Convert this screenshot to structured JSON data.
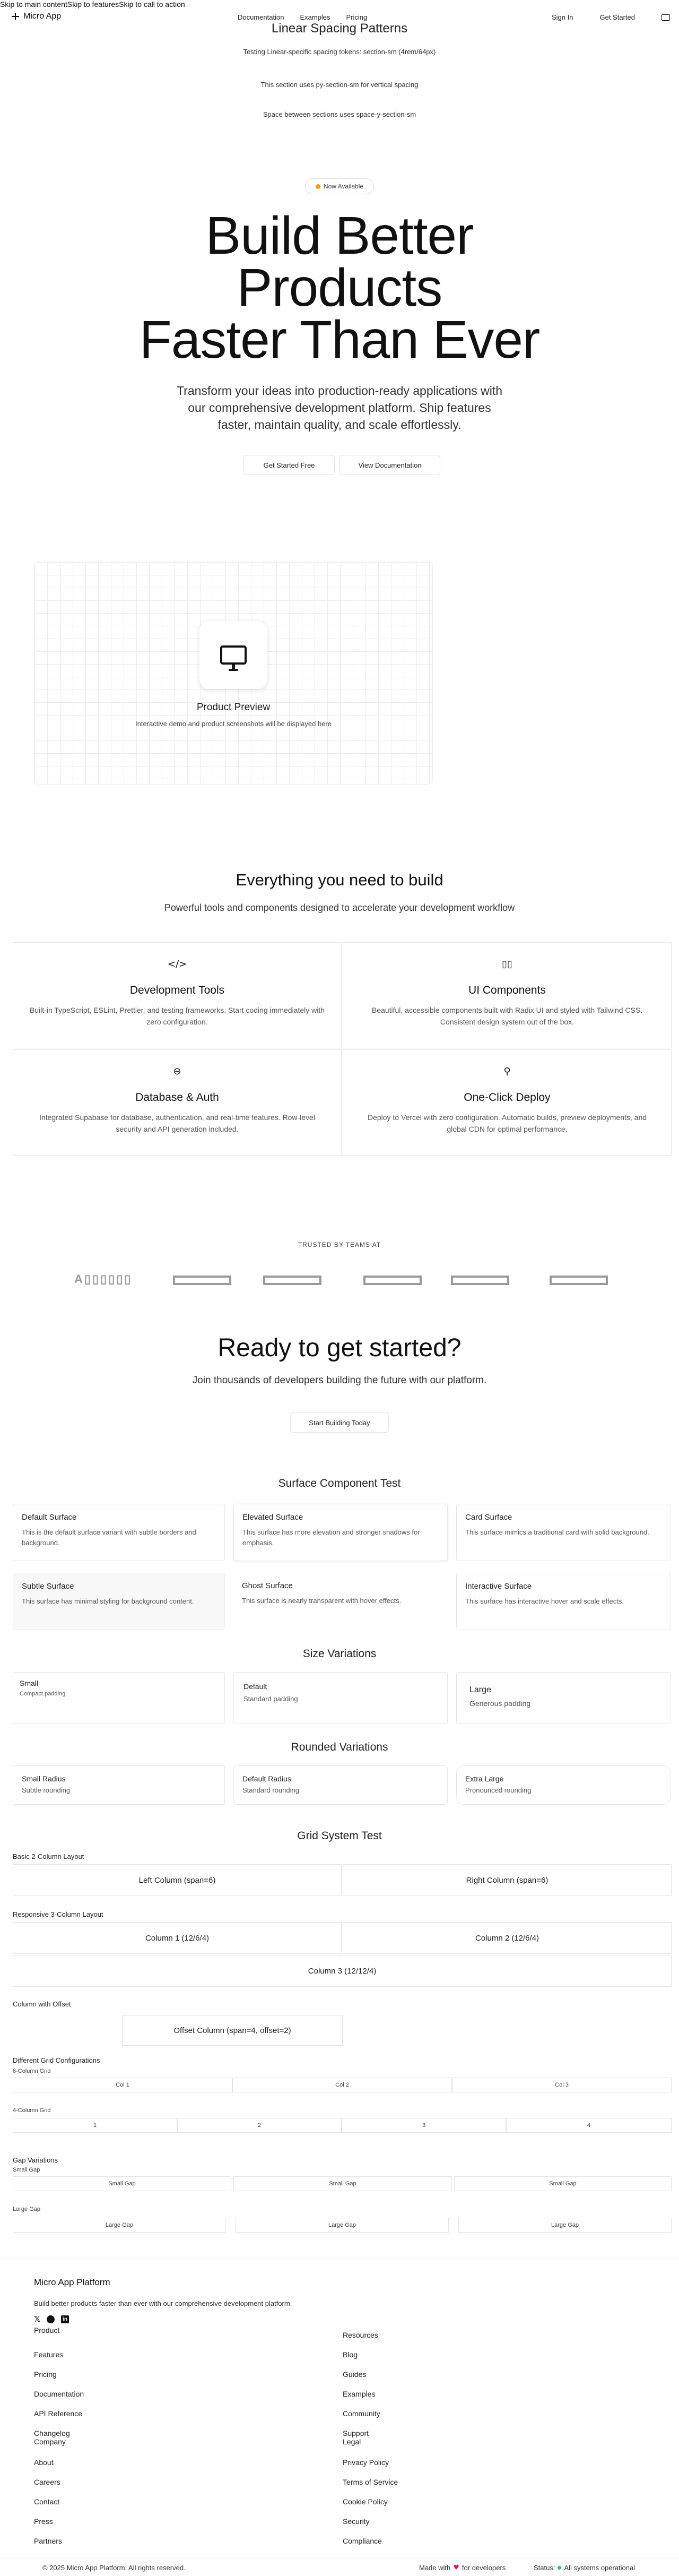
{
  "skip_links": [
    "Skip to main content",
    "Skip to features",
    "Skip to call to action"
  ],
  "nav": {
    "logo": "Micro App",
    "links": [
      "Documentation",
      "Examples",
      "Pricing"
    ],
    "sign_in": "Sign In",
    "get_started": "Get Started"
  },
  "spacing": {
    "title": "Linear Spacing Patterns",
    "line1": "Testing Linear-specific spacing tokens: section-sm (4rem/64px)",
    "line2": "This section uses py-section-sm for vertical spacing",
    "line3": "Space between sections uses space-y-section-sm"
  },
  "hero": {
    "badge": "Now Available",
    "title_line1": "Build Better",
    "title_line2": "Products",
    "title_line3": "Faster Than Ever",
    "subtitle": "Transform your ideas into production-ready applications with our comprehensive development platform. Ship features faster, maintain quality, and scale effortlessly.",
    "primary_cta": "Get Started Free",
    "secondary_cta": "View Documentation"
  },
  "preview": {
    "icon": "monitor-icon",
    "title": "Product Preview",
    "desc": "Interactive demo and product screenshots will be displayed here"
  },
  "features": {
    "title": "Everything you need to build",
    "subtitle": "Powerful tools and components designed to accelerate your development workflow",
    "items": [
      {
        "icon": "code-icon",
        "glyph": "</>",
        "title": "Development Tools",
        "desc": "Built-in TypeScript, ESLint, Prettier, and testing frameworks. Start coding immediately with zero configuration."
      },
      {
        "icon": "components-icon",
        "glyph": "▯▯",
        "title": "UI Components",
        "desc": "Beautiful, accessible components built with Radix UI and styled with Tailwind CSS. Consistent design system out of the box."
      },
      {
        "icon": "database-icon",
        "glyph": "⊖",
        "title": "Database & Auth",
        "desc": "Integrated Supabase for database, authentication, and real-time features. Row-level security and API generation included."
      },
      {
        "icon": "rocket-icon",
        "glyph": "⚲",
        "title": "One-Click Deploy",
        "desc": "Deploy to Vercel with zero configuration. Automatic builds, preview deployments, and global CDN for optimal performance."
      }
    ]
  },
  "trusted": {
    "label": "TRUSTED BY TEAMS AT",
    "first_logo": "A▯▯▯▯▯▯"
  },
  "cta": {
    "title": "Ready to get started?",
    "subtitle": "Join thousands of developers building the future with our platform.",
    "button": "Start Building Today"
  },
  "surface": {
    "title": "Surface Component Test",
    "cards": [
      {
        "title": "Default Surface",
        "desc": "This is the default surface variant with subtle borders and background."
      },
      {
        "title": "Elevated Surface",
        "desc": "This surface has more elevation and stronger shadows for emphasis."
      },
      {
        "title": "Card Surface",
        "desc": "This surface mimics a traditional card with solid background."
      },
      {
        "title": "Subtle Surface",
        "desc": "This surface has minimal styling for background content."
      },
      {
        "title": "Ghost Surface",
        "desc": "This surface is nearly transparent with hover effects."
      },
      {
        "title": "Interactive Surface",
        "desc": "This surface has interactive hover and scale effects."
      }
    ],
    "sizes_title": "Size Variations",
    "sizes": [
      {
        "title": "Small",
        "desc": "Compact padding"
      },
      {
        "title": "Default",
        "desc": "Standard padding"
      },
      {
        "title": "Large",
        "desc": "Generous padding"
      }
    ],
    "radius_title": "Rounded Variations",
    "radius": [
      {
        "title": "Small Radius",
        "desc": "Subtle rounding"
      },
      {
        "title": "Default Radius",
        "desc": "Standard rounding"
      },
      {
        "title": "Extra Large",
        "desc": "Pronounced rounding"
      }
    ]
  },
  "grid": {
    "title": "Grid System Test",
    "basic_label": "Basic 2-Column Layout",
    "left_col": "Left Column (span=6)",
    "right_col": "Right Column (span=6)",
    "responsive_label": "Responsive 3-Column Layout",
    "col1": "Column 1 (12/6/4)",
    "col2": "Column 2 (12/6/4)",
    "col3": "Column 3 (12/12/4)",
    "offset_label": "Column with Offset",
    "offset_col": "Offset Column (span=4, offset=2)",
    "configs_label": "Different Grid Configurations",
    "six_label": "6-Column Grid",
    "six_cells": [
      "Col 1",
      "Col 2",
      "Col 3"
    ],
    "four_label": "4-Column Grid",
    "four_cells": [
      "1",
      "2",
      "3",
      "4"
    ],
    "gap_label": "Gap Variations",
    "small_gap_label": "Small Gap",
    "small_gap_cells": [
      "Small Gap",
      "Small Gap",
      "Small Gap"
    ],
    "large_gap_label": "Large Gap",
    "large_gap_cells": [
      "Large Gap",
      "Large Gap",
      "Large Gap"
    ]
  },
  "footer": {
    "brand": "Micro App Platform",
    "tagline": "Build better products faster than ever with our comprehensive development platform.",
    "social": [
      "x-icon",
      "github-icon",
      "linkedin-icon"
    ],
    "product_heading": "Product",
    "resources_heading": "Resources",
    "left_links": [
      "Features",
      "Pricing",
      "Documentation",
      "API Reference",
      "Changelog",
      "Company"
    ],
    "right_links": [
      "Blog",
      "Guides",
      "Examples",
      "Community",
      "Support",
      "Legal"
    ],
    "company_links": [
      "About",
      "Careers",
      "Contact",
      "Press",
      "Partners"
    ],
    "legal_links": [
      "Privacy Policy",
      "Terms of Service",
      "Cookie Policy",
      "Security",
      "Compliance"
    ],
    "copyright": "© 2025 Micro App Platform. All rights reserved.",
    "made_with": "Made with",
    "for_devs": "for developers",
    "status_label": "Status:",
    "status": "All systems operational",
    "heart_color": "#e11d48",
    "status_color": "#22c55e"
  }
}
